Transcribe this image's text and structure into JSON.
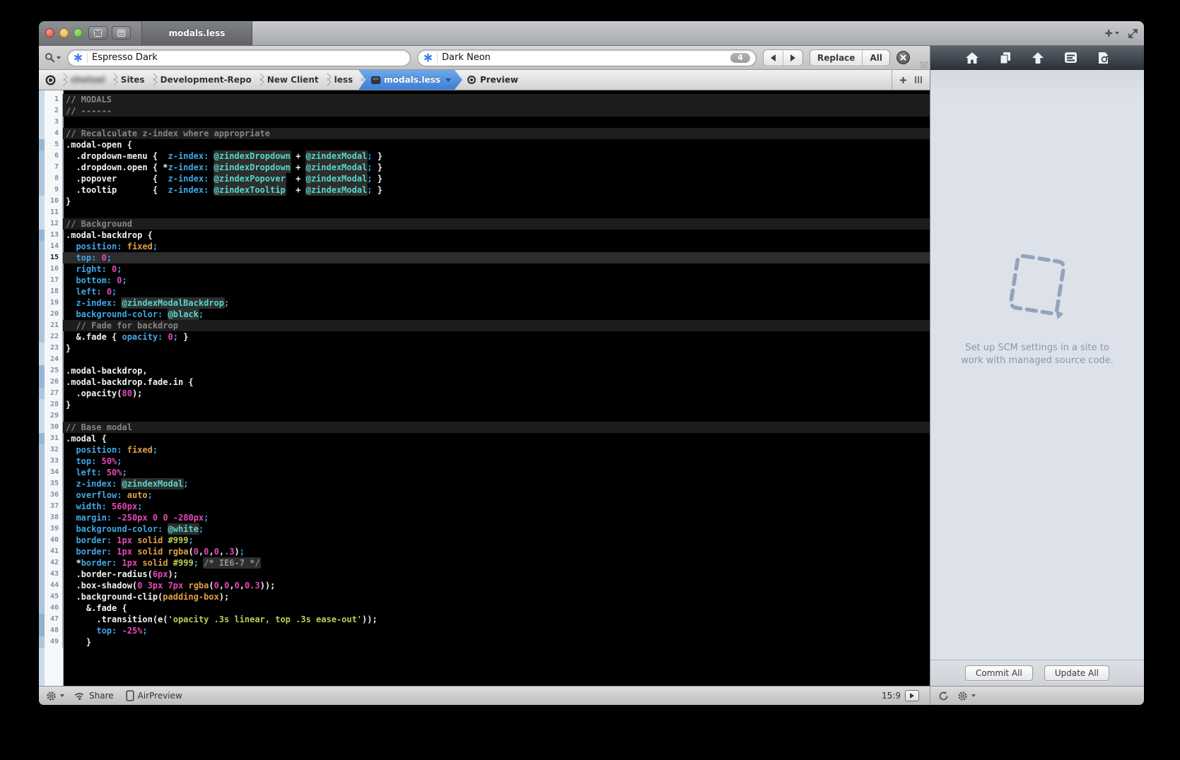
{
  "titlebar": {
    "tab_title": "modals.less"
  },
  "findbar": {
    "find_value": "Espresso Dark",
    "replace_value": "Dark Neon",
    "match_count": "4",
    "replace_label": "Replace",
    "all_label": "All"
  },
  "breadcrumb": {
    "items": [
      {
        "label": "shetzel",
        "blurred": true
      },
      {
        "label": "Sites",
        "blurred": false
      },
      {
        "label": "Development-Repo",
        "blurred": false
      },
      {
        "label": "New Client",
        "blurred": false
      },
      {
        "label": "less",
        "blurred": false
      }
    ],
    "active_file": "modals.less",
    "preview_label": "Preview"
  },
  "sidebar": {
    "message_line1": "Set up SCM settings in a site to",
    "message_line2": "work with managed source code.",
    "commit_label": "Commit All",
    "update_label": "Update All"
  },
  "statusbar": {
    "share_label": "Share",
    "airpreview_label": "AirPreview",
    "cursor_position": "15:9"
  },
  "colors": {
    "editor_bg": "#000000",
    "comment_row_bg": "#1d1d1d",
    "current_line_bg": "#2c2c2c",
    "syntax_plain": "#f2f2f2",
    "syntax_property": "#3fa9e6",
    "syntax_variable": "#55d7cb",
    "syntax_keyword": "#e0a045",
    "syntax_number": "#e649b8",
    "syntax_string": "#bacf55",
    "syntax_comment": "#858585",
    "active_crumb_blue": "#3c7ed6",
    "find_asterisk_blue": "#3a7de8"
  },
  "editor": {
    "lines": [
      {
        "t": "comment",
        "d": 0,
        "tok": [
          [
            "c",
            "// MODALS"
          ]
        ]
      },
      {
        "t": "comment",
        "d": 0,
        "tok": [
          [
            "c",
            "// ------"
          ]
        ]
      },
      {
        "t": "blank",
        "d": 0,
        "tok": []
      },
      {
        "t": "comment",
        "d": 0,
        "tok": [
          [
            "c",
            "// Recalculate z-index where appropriate"
          ]
        ]
      },
      {
        "d": 1,
        "tok": [
          [
            "w",
            ".modal-open {"
          ]
        ]
      },
      {
        "d": 2,
        "tok": [
          [
            "w",
            "  .dropdown-menu {  "
          ],
          [
            "p",
            "z-index:"
          ],
          [
            "w",
            " "
          ],
          [
            "v",
            "@zindexDropdown"
          ],
          [
            "w",
            " + "
          ],
          [
            "v",
            "@zindexModal"
          ],
          [
            "p",
            ";"
          ],
          [
            "w",
            " }"
          ]
        ]
      },
      {
        "d": 2,
        "tok": [
          [
            "w",
            "  .dropdown.open { *"
          ],
          [
            "p",
            "z-index:"
          ],
          [
            "w",
            " "
          ],
          [
            "v",
            "@zindexDropdown"
          ],
          [
            "w",
            " + "
          ],
          [
            "v",
            "@zindexModal"
          ],
          [
            "p",
            ";"
          ],
          [
            "w",
            " }"
          ]
        ]
      },
      {
        "d": 2,
        "tok": [
          [
            "w",
            "  .popover       {  "
          ],
          [
            "p",
            "z-index:"
          ],
          [
            "w",
            " "
          ],
          [
            "v",
            "@zindexPopover"
          ],
          [
            "w",
            "  + "
          ],
          [
            "v",
            "@zindexModal"
          ],
          [
            "p",
            ";"
          ],
          [
            "w",
            " }"
          ]
        ]
      },
      {
        "d": 2,
        "tok": [
          [
            "w",
            "  .tooltip       {  "
          ],
          [
            "p",
            "z-index:"
          ],
          [
            "w",
            " "
          ],
          [
            "v",
            "@zindexTooltip"
          ],
          [
            "w",
            "  + "
          ],
          [
            "v",
            "@zindexModal"
          ],
          [
            "p",
            ";"
          ],
          [
            "w",
            " }"
          ]
        ]
      },
      {
        "d": 0,
        "tok": [
          [
            "w",
            "}"
          ]
        ]
      },
      {
        "t": "blank",
        "d": 0,
        "tok": []
      },
      {
        "t": "comment",
        "d": 0,
        "tok": [
          [
            "c",
            "// Background"
          ]
        ]
      },
      {
        "d": 1,
        "tok": [
          [
            "w",
            ".modal-backdrop {"
          ]
        ]
      },
      {
        "d": 2,
        "tok": [
          [
            "w",
            "  "
          ],
          [
            "p",
            "position:"
          ],
          [
            "w",
            " "
          ],
          [
            "o",
            "fixed"
          ],
          [
            "p",
            ";"
          ]
        ]
      },
      {
        "t": "current",
        "d": 2,
        "tok": [
          [
            "w",
            "  "
          ],
          [
            "p",
            "top:"
          ],
          [
            "w",
            " "
          ],
          [
            "n",
            "0"
          ],
          [
            "p",
            ";"
          ]
        ]
      },
      {
        "d": 2,
        "tok": [
          [
            "w",
            "  "
          ],
          [
            "p",
            "right:"
          ],
          [
            "w",
            " "
          ],
          [
            "n",
            "0"
          ],
          [
            "p",
            ";"
          ]
        ]
      },
      {
        "d": 2,
        "tok": [
          [
            "w",
            "  "
          ],
          [
            "p",
            "bottom:"
          ],
          [
            "w",
            " "
          ],
          [
            "n",
            "0"
          ],
          [
            "p",
            ";"
          ]
        ]
      },
      {
        "d": 2,
        "tok": [
          [
            "w",
            "  "
          ],
          [
            "p",
            "left:"
          ],
          [
            "w",
            " "
          ],
          [
            "n",
            "0"
          ],
          [
            "p",
            ";"
          ]
        ]
      },
      {
        "d": 2,
        "tok": [
          [
            "w",
            "  "
          ],
          [
            "p",
            "z-index:"
          ],
          [
            "w",
            " "
          ],
          [
            "v",
            "@zindexModalBackdrop"
          ],
          [
            "p",
            ";"
          ]
        ]
      },
      {
        "d": 2,
        "tok": [
          [
            "w",
            "  "
          ],
          [
            "p",
            "background-color:"
          ],
          [
            "w",
            " "
          ],
          [
            "v",
            "@black"
          ],
          [
            "p",
            ";"
          ]
        ]
      },
      {
        "t": "comment",
        "d": 2,
        "tok": [
          [
            "c",
            "  // Fade for backdrop"
          ]
        ]
      },
      {
        "d": 2,
        "tok": [
          [
            "w",
            "  &.fade { "
          ],
          [
            "p",
            "opacity:"
          ],
          [
            "w",
            " "
          ],
          [
            "n",
            "0"
          ],
          [
            "p",
            ";"
          ],
          [
            "w",
            " }"
          ]
        ]
      },
      {
        "d": 0,
        "tok": [
          [
            "w",
            "}"
          ]
        ]
      },
      {
        "t": "blank",
        "d": 0,
        "tok": []
      },
      {
        "d": 1,
        "tok": [
          [
            "w",
            ".modal-backdrop,"
          ]
        ]
      },
      {
        "d": 1,
        "tok": [
          [
            "w",
            ".modal-backdrop.fade.in {"
          ]
        ]
      },
      {
        "d": 2,
        "tok": [
          [
            "w",
            "  .opacity("
          ],
          [
            "n",
            "80"
          ],
          [
            "w",
            ");"
          ]
        ]
      },
      {
        "d": 0,
        "tok": [
          [
            "w",
            "}"
          ]
        ]
      },
      {
        "t": "blank",
        "d": 0,
        "tok": []
      },
      {
        "t": "comment",
        "d": 0,
        "tok": [
          [
            "c",
            "// Base modal"
          ]
        ]
      },
      {
        "d": 1,
        "tok": [
          [
            "w",
            ".modal {"
          ]
        ]
      },
      {
        "d": 2,
        "tok": [
          [
            "w",
            "  "
          ],
          [
            "p",
            "position:"
          ],
          [
            "w",
            " "
          ],
          [
            "o",
            "fixed"
          ],
          [
            "p",
            ";"
          ]
        ]
      },
      {
        "d": 2,
        "tok": [
          [
            "w",
            "  "
          ],
          [
            "p",
            "top:"
          ],
          [
            "w",
            " "
          ],
          [
            "n",
            "50%"
          ],
          [
            "p",
            ";"
          ]
        ]
      },
      {
        "d": 2,
        "tok": [
          [
            "w",
            "  "
          ],
          [
            "p",
            "left:"
          ],
          [
            "w",
            " "
          ],
          [
            "n",
            "50%"
          ],
          [
            "p",
            ";"
          ]
        ]
      },
      {
        "d": 2,
        "tok": [
          [
            "w",
            "  "
          ],
          [
            "p",
            "z-index:"
          ],
          [
            "w",
            " "
          ],
          [
            "v",
            "@zindexModal"
          ],
          [
            "p",
            ";"
          ]
        ]
      },
      {
        "d": 2,
        "tok": [
          [
            "w",
            "  "
          ],
          [
            "p",
            "overflow:"
          ],
          [
            "w",
            " "
          ],
          [
            "o",
            "auto"
          ],
          [
            "p",
            ";"
          ]
        ]
      },
      {
        "d": 2,
        "tok": [
          [
            "w",
            "  "
          ],
          [
            "p",
            "width:"
          ],
          [
            "w",
            " "
          ],
          [
            "n",
            "560px"
          ],
          [
            "p",
            ";"
          ]
        ]
      },
      {
        "d": 2,
        "tok": [
          [
            "w",
            "  "
          ],
          [
            "p",
            "margin:"
          ],
          [
            "w",
            " "
          ],
          [
            "n",
            "-250px"
          ],
          [
            "w",
            " "
          ],
          [
            "n",
            "0"
          ],
          [
            "w",
            " "
          ],
          [
            "n",
            "0"
          ],
          [
            "w",
            " "
          ],
          [
            "n",
            "-280px"
          ],
          [
            "p",
            ";"
          ]
        ]
      },
      {
        "d": 2,
        "tok": [
          [
            "w",
            "  "
          ],
          [
            "p",
            "background-color:"
          ],
          [
            "w",
            " "
          ],
          [
            "v",
            "@white"
          ],
          [
            "p",
            ";"
          ]
        ]
      },
      {
        "d": 2,
        "tok": [
          [
            "w",
            "  "
          ],
          [
            "p",
            "border:"
          ],
          [
            "w",
            " "
          ],
          [
            "n",
            "1px"
          ],
          [
            "w",
            " "
          ],
          [
            "o",
            "solid"
          ],
          [
            "w",
            " "
          ],
          [
            "s",
            "#999"
          ],
          [
            "p",
            ";"
          ]
        ]
      },
      {
        "d": 2,
        "tok": [
          [
            "w",
            "  "
          ],
          [
            "p",
            "border:"
          ],
          [
            "w",
            " "
          ],
          [
            "n",
            "1px"
          ],
          [
            "w",
            " "
          ],
          [
            "o",
            "solid"
          ],
          [
            "w",
            " "
          ],
          [
            "o",
            "rgba"
          ],
          [
            "w",
            "("
          ],
          [
            "n",
            "0"
          ],
          [
            "w",
            ","
          ],
          [
            "n",
            "0"
          ],
          [
            "w",
            ","
          ],
          [
            "n",
            "0"
          ],
          [
            "w",
            ","
          ],
          [
            "n",
            ".3"
          ],
          [
            "w",
            ")"
          ],
          [
            "p",
            ";"
          ]
        ]
      },
      {
        "d": 2,
        "tok": [
          [
            "w",
            "  *"
          ],
          [
            "p",
            "border:"
          ],
          [
            "w",
            " "
          ],
          [
            "n",
            "1px"
          ],
          [
            "w",
            " "
          ],
          [
            "o",
            "solid"
          ],
          [
            "w",
            " "
          ],
          [
            "s",
            "#999"
          ],
          [
            "p",
            ";"
          ],
          [
            "w",
            " "
          ],
          [
            "i",
            "/* IE6-7 */"
          ]
        ]
      },
      {
        "d": 2,
        "tok": [
          [
            "w",
            "  .border-radius("
          ],
          [
            "n",
            "6px"
          ],
          [
            "w",
            ");"
          ]
        ]
      },
      {
        "d": 2,
        "tok": [
          [
            "w",
            "  .box-shadow("
          ],
          [
            "n",
            "0"
          ],
          [
            "w",
            " "
          ],
          [
            "n",
            "3px"
          ],
          [
            "w",
            " "
          ],
          [
            "n",
            "7px"
          ],
          [
            "w",
            " "
          ],
          [
            "o",
            "rgba"
          ],
          [
            "w",
            "("
          ],
          [
            "n",
            "0"
          ],
          [
            "w",
            ","
          ],
          [
            "n",
            "0"
          ],
          [
            "w",
            ","
          ],
          [
            "n",
            "0"
          ],
          [
            "w",
            ","
          ],
          [
            "n",
            "0.3"
          ],
          [
            "w",
            "));"
          ]
        ]
      },
      {
        "d": 2,
        "tok": [
          [
            "w",
            "  .background-clip("
          ],
          [
            "o",
            "padding-box"
          ],
          [
            "w",
            ");"
          ]
        ]
      },
      {
        "d": 2,
        "tok": [
          [
            "w",
            "    &.fade {"
          ]
        ]
      },
      {
        "d": 3,
        "tok": [
          [
            "w",
            "      .transition(e("
          ],
          [
            "s",
            "'opacity .3s linear, top .3s ease-out'"
          ],
          [
            "w",
            "));"
          ]
        ]
      },
      {
        "d": 3,
        "tok": [
          [
            "w",
            "      "
          ],
          [
            "p",
            "top:"
          ],
          [
            "w",
            " "
          ],
          [
            "n",
            "-25%"
          ],
          [
            "p",
            ";"
          ]
        ]
      },
      {
        "d": 2,
        "tok": [
          [
            "w",
            "    }"
          ]
        ]
      }
    ]
  }
}
